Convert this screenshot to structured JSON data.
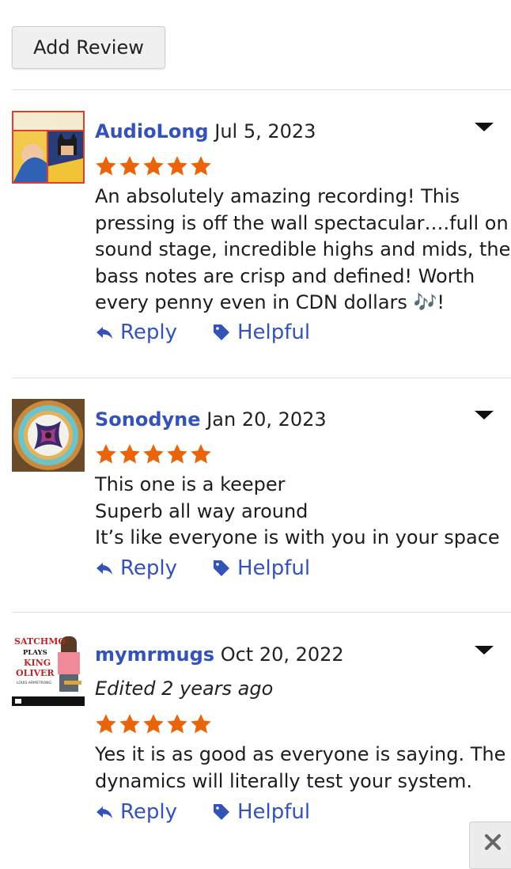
{
  "add_review_label": "Add Review",
  "reviews": [
    {
      "username": "AudioLong",
      "date": "Jul 5, 2023",
      "rating": 5,
      "body_lines": [
        "An absolutely amazing recording! This",
        "pressing is off the wall spectacular….full on",
        "sound stage, incredible highs and mids, the",
        "bass notes are crisp and defined! Worth",
        "every penny even in CDN dollars 🎶!"
      ],
      "reply_label": "Reply",
      "helpful_label": "Helpful"
    },
    {
      "username": "Sonodyne",
      "date": "Jan 20, 2023",
      "rating": 5,
      "body_lines": [
        "This one is a keeper",
        "Superb all way around",
        "It’s like everyone is with you in your space"
      ],
      "reply_label": "Reply",
      "helpful_label": "Helpful"
    },
    {
      "username": "mymrmugs",
      "date": "Oct 20, 2022",
      "edited_note": "Edited 2 years ago",
      "rating": 5,
      "body_lines": [
        "Yes it is as good as everyone is saying. The",
        "dynamics will literally test your system."
      ],
      "reply_label": "Reply",
      "helpful_label": "Helpful",
      "avatar_text": [
        "SATCHMO",
        "PLAYS",
        "KING",
        "OLIVER",
        "LOUIS ARMSTRONG"
      ]
    }
  ],
  "colors": {
    "username": "#3353b8",
    "link": "#3353b8",
    "star": "#e8650b",
    "divider": "#dddddd"
  },
  "icons": {
    "reply": "reply-arrow-icon",
    "helpful": "tag-icon",
    "menu": "caret-down-icon",
    "close": "close-x-icon"
  }
}
